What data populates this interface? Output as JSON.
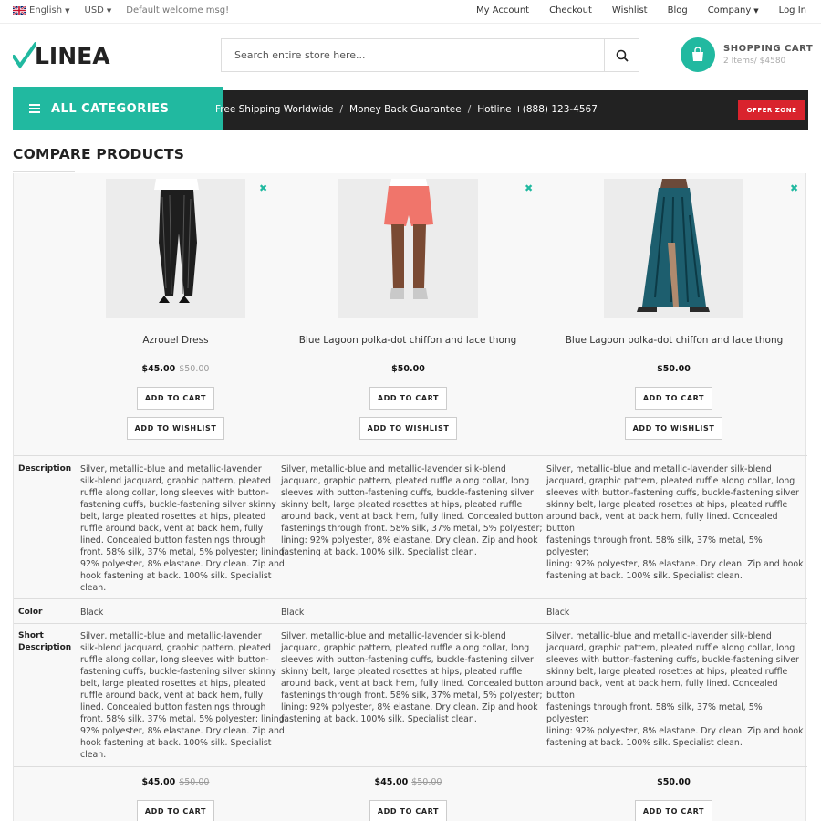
{
  "topbar": {
    "language": "English",
    "currency": "USD",
    "welcome": "Default welcome msg!",
    "links": [
      "My Account",
      "Checkout",
      "Wishlist",
      "Blog",
      "Company",
      "Log In"
    ]
  },
  "header": {
    "logo": "LINEA",
    "search_placeholder": "Search entire store here...",
    "cart_title": "SHOPPING CART",
    "cart_summary": "2 Items/ $4580"
  },
  "nav": {
    "all_categories": "ALL CATEGORIES",
    "link1": "Free Shipping Worldwide",
    "link2": "Money Back Guarantee",
    "link3": "Hotline +(888) 123-4567",
    "separator": "/",
    "offer": "OFFER ZONE"
  },
  "page_title": "COMPARE PRODUCTS",
  "labels": {
    "add_to_cart": "ADD TO CART",
    "add_to_wishlist": "ADD TO WISHLIST",
    "description": "Description",
    "color": "Color",
    "short_description": "Short Description"
  },
  "products": [
    {
      "name": "Azrouel Dress",
      "price": "$45.00",
      "old_price": "$50.00",
      "bottom_price": "$45.00",
      "bottom_old_price": "$50.00",
      "color": "Black",
      "image": "black-pinstripe-trousers"
    },
    {
      "name": "Blue Lagoon polka-dot chiffon and lace thong",
      "price": "$50.00",
      "old_price": "",
      "bottom_price": "$45.00",
      "bottom_old_price": "$50.00",
      "color": "Black",
      "image": "coral-shorts"
    },
    {
      "name": "Blue Lagoon polka-dot chiffon and lace thong",
      "price": "$50.00",
      "old_price": "",
      "bottom_price": "$50.00",
      "bottom_old_price": "",
      "color": "Black",
      "image": "teal-maxi-skirt"
    }
  ],
  "desc_col1": [
    "Silver, metallic-blue and metallic-lavender",
    "silk-blend jacquard, graphic pattern, pleated",
    "ruffle along collar, long sleeves with button-",
    "fastening cuffs, buckle-fastening silver skinny",
    "belt, large pleated rosettes at hips, pleated",
    "ruffle around back, vent at back hem, fully",
    "lined. Concealed button fastenings through",
    "front. 58% silk, 37% metal, 5% polyester; lining:",
    "92% polyester, 8% elastane. Dry clean. Zip and",
    "hook fastening at back. 100% silk. Specialist",
    "clean."
  ],
  "desc_col2": [
    "Silver, metallic-blue and metallic-lavender silk-blend",
    "jacquard, graphic pattern, pleated ruffle along collar, long",
    "sleeves with button-fastening cuffs, buckle-fastening silver",
    "skinny belt, large pleated rosettes at hips, pleated ruffle",
    "around back, vent at back hem, fully lined. Concealed button",
    "fastenings through front. 58% silk, 37% metal, 5% polyester;",
    "lining: 92% polyester, 8% elastane. Dry clean. Zip and hook",
    "fastening at back. 100% silk. Specialist clean."
  ],
  "colors": {
    "accent": "#21b9a0",
    "navbar": "#222222",
    "offer": "#d9232d"
  }
}
